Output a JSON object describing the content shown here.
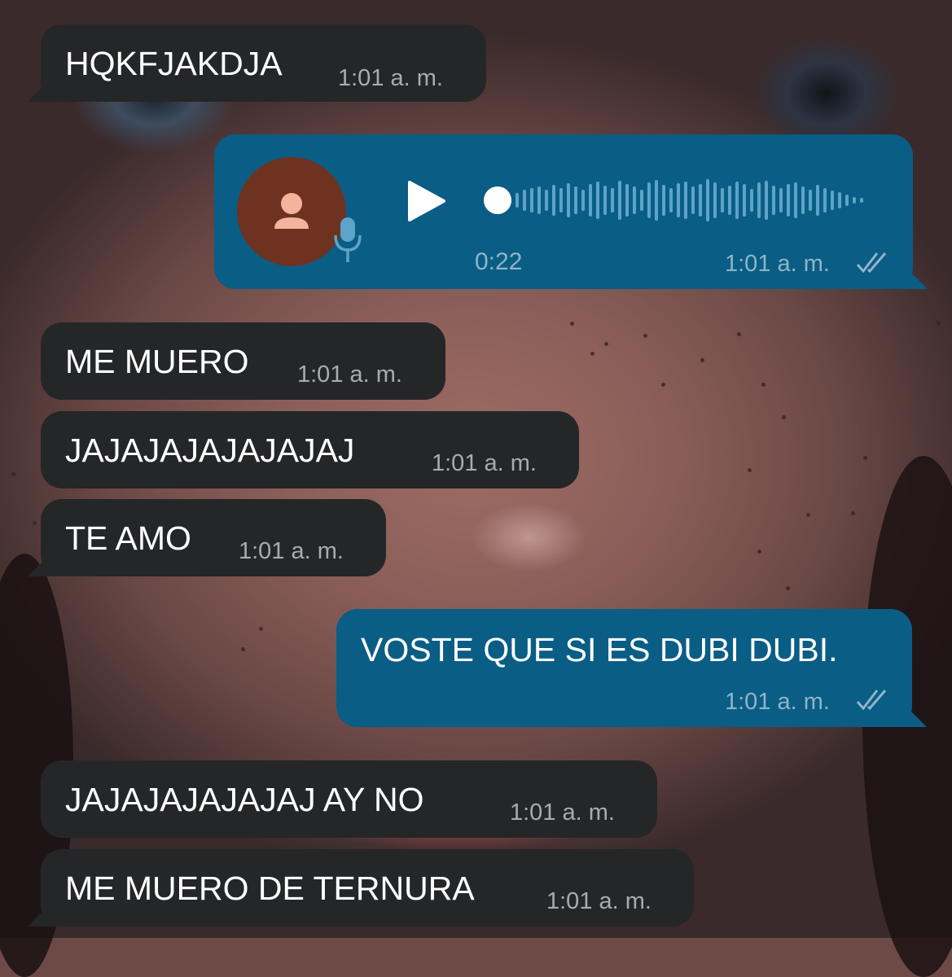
{
  "messages": [
    {
      "id": "m1",
      "direction": "incoming",
      "text": "HQKFJAKDJA",
      "time": "1:01 a. m."
    },
    {
      "id": "m2",
      "direction": "outgoing",
      "type": "voice",
      "duration": "0:22",
      "time": "1:01 a. m.",
      "status": "read"
    },
    {
      "id": "m3",
      "direction": "incoming",
      "text": "ME MUERO",
      "time": "1:01 a. m."
    },
    {
      "id": "m4",
      "direction": "incoming",
      "text": "JAJAJAJAJAJAJAJ",
      "time": "1:01 a. m."
    },
    {
      "id": "m5",
      "direction": "incoming",
      "text": "TE AMO",
      "time": "1:01 a. m."
    },
    {
      "id": "m6",
      "direction": "outgoing",
      "text": "VOSTE QUE SI ES DUBI DUBI.",
      "time": "1:01 a. m.",
      "status": "read"
    },
    {
      "id": "m7",
      "direction": "incoming",
      "text": "JAJAJAJAJAJAJ AY NO",
      "time": "1:01 a. m."
    },
    {
      "id": "m8",
      "direction": "incoming",
      "text": "ME MUERO DE TERNURA",
      "time": "1:01 a. m."
    }
  ],
  "icons": {
    "play": "play-icon",
    "mic": "microphone-icon",
    "avatar": "person-icon",
    "read": "double-check-icon"
  },
  "colors": {
    "incoming_bubble": "#252628",
    "outgoing_bubble": "#0a5d85",
    "avatar_bg": "#6e3221",
    "time_in": "#a8abb0",
    "time_out": "#8fb4c9"
  },
  "voice_progress": 0
}
